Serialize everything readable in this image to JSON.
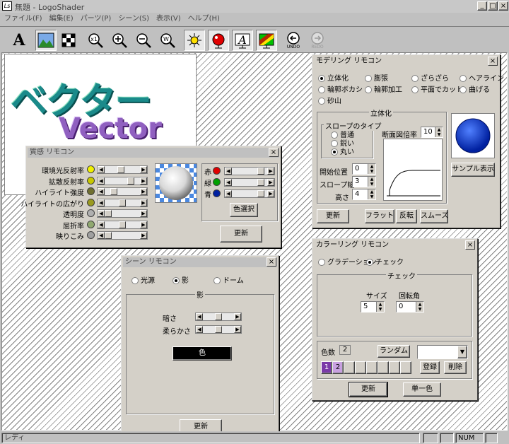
{
  "window": {
    "title": "無題 - LogoShader",
    "min": "_",
    "max": "□",
    "close": "×"
  },
  "menu": [
    "ファイル(F)",
    "編集(E)",
    "パーツ(P)",
    "シーン(S)",
    "表示(V)",
    "ヘルプ(H)"
  ],
  "toolbar": {
    "undo": "UNDO",
    "redo": "REDO",
    "text_tool": "A",
    "zoom1": "x1",
    "zoomw": "W"
  },
  "canvas": {
    "katakana": "ベクター",
    "latin": "Vector"
  },
  "modeling": {
    "title": "モデリング リモコン",
    "radios": [
      {
        "label": "立体化",
        "on": true
      },
      {
        "label": "膨張",
        "on": false
      },
      {
        "label": "ざらざら",
        "on": false
      },
      {
        "label": "ヘアライン",
        "on": false
      },
      {
        "label": "輪郭ボカシ",
        "on": false
      },
      {
        "label": "輪郭加工",
        "on": false
      },
      {
        "label": "平面でカット",
        "on": false
      },
      {
        "label": "曲げる",
        "on": false
      },
      {
        "label": "砂山",
        "on": false
      }
    ],
    "group_label": "立体化",
    "slope_type_label": "スロープのタイプ",
    "slope_types": [
      {
        "label": "普通",
        "on": false
      },
      {
        "label": "鋭い",
        "on": false
      },
      {
        "label": "丸い",
        "on": true
      }
    ],
    "ratio_label": "断面図倍率",
    "ratio_value": "10",
    "start_label": "開始位置",
    "start_value": "0",
    "width_label": "スロープ幅",
    "width_value": "3",
    "height_label": "高さ",
    "height_value": "4",
    "sample_button": "サンプル表示",
    "update_button": "更新",
    "flat_button": "フラット",
    "invert_button": "反転",
    "smooth_button": "スムーズ"
  },
  "material": {
    "title": "質感 リモコン",
    "rows": [
      {
        "label": "環境光反射率",
        "level": 0.45
      },
      {
        "label": "拡散反射率",
        "level": 0.8
      },
      {
        "label": "ハイライト強度",
        "level": 0.2
      },
      {
        "label": "ハイライトの広がり",
        "level": 0.5
      },
      {
        "label": "透明度",
        "level": 0.0
      },
      {
        "label": "屈折率",
        "level": 0.5
      },
      {
        "label": "映りこみ",
        "level": 0.0
      }
    ],
    "rgb": [
      {
        "label": "赤",
        "color": "#e00000",
        "level": 0.9
      },
      {
        "label": "緑",
        "color": "#00a000",
        "level": 0.9
      },
      {
        "label": "青",
        "color": "#0020a0",
        "level": 0.9
      }
    ],
    "color_select": "色選択",
    "update_button": "更新"
  },
  "scene": {
    "title": "シーン リモコン",
    "radios": [
      {
        "label": "光源",
        "on": false
      },
      {
        "label": "影",
        "on": true
      },
      {
        "label": "ドーム",
        "on": false
      }
    ],
    "group_label": "影",
    "dark_label": "暗さ",
    "soft_label": "柔らかさ",
    "dark_level": 0.5,
    "soft_level": 0.5,
    "color_button": "色",
    "update_button": "更新"
  },
  "coloring": {
    "title": "カラーリング リモコン",
    "radios": [
      {
        "label": "グラデーション",
        "on": false
      },
      {
        "label": "チェック",
        "on": true
      }
    ],
    "group_label": "チェック",
    "size_label": "サイズ",
    "size_value": "5",
    "angle_label": "回転角",
    "angle_value": "0",
    "count_label": "色数",
    "count_value": "2",
    "random_button": "ランダム",
    "swatches": [
      "1",
      "2",
      "",
      "",
      "",
      "",
      "",
      ""
    ],
    "register_button": "登録",
    "delete_button": "削除",
    "update_button": "更新",
    "single_button": "単一色"
  },
  "status": {
    "text": "レディ",
    "num": "NUM"
  }
}
